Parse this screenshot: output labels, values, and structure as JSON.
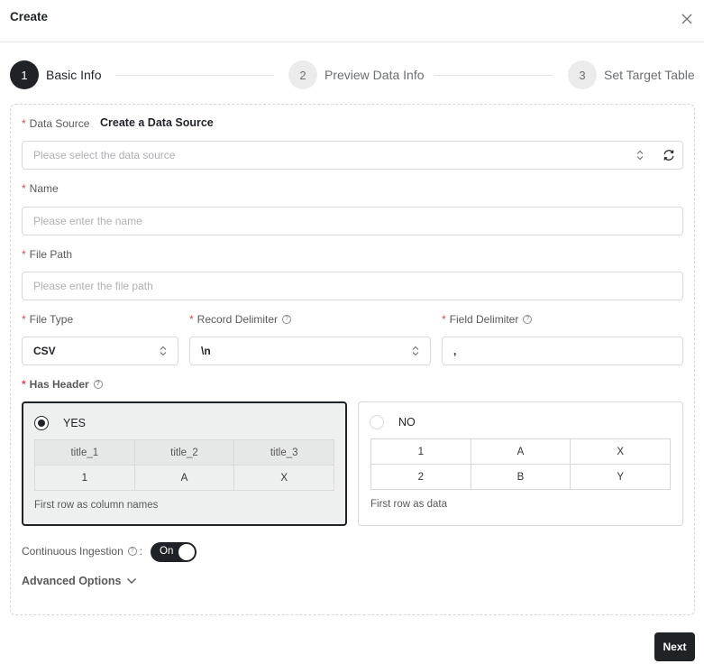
{
  "dialog": {
    "title": "Create"
  },
  "steps": [
    {
      "number": "1",
      "label": "Basic Info",
      "state": "active"
    },
    {
      "number": "2",
      "label": "Preview Data Info",
      "state": "inactive"
    },
    {
      "number": "3",
      "label": "Set Target Table",
      "state": "inactive"
    }
  ],
  "form": {
    "data_source": {
      "label": "Data Source",
      "create_link": "Create a Data Source",
      "placeholder": "Please select the data source"
    },
    "name": {
      "label": "Name",
      "placeholder": "Please enter the name"
    },
    "file_path": {
      "label": "File Path",
      "placeholder": "Please enter the file path"
    },
    "file_type": {
      "label": "File Type",
      "value": "CSV"
    },
    "record_delimiter": {
      "label": "Record Delimiter",
      "value": "\\n"
    },
    "field_delimiter": {
      "label": "Field Delimiter",
      "value": ","
    },
    "has_header": {
      "label": "Has Header",
      "yes": {
        "label": "YES",
        "selected": true,
        "header": [
          "title_1",
          "title_2",
          "title_3"
        ],
        "row": [
          "1",
          "A",
          "X"
        ],
        "note": "First row as column names"
      },
      "no": {
        "label": "NO",
        "selected": false,
        "rows": [
          [
            "1",
            "A",
            "X"
          ],
          [
            "2",
            "B",
            "Y"
          ]
        ],
        "note": "First row as data"
      }
    },
    "continuous_ingestion": {
      "label": "Continuous Ingestion",
      "colon": ":",
      "toggle_text": "On",
      "enabled": true
    },
    "advanced_options": {
      "label": "Advanced Options"
    }
  },
  "footer": {
    "next_label": "Next"
  },
  "icons": {
    "close": "close-icon",
    "caret": "up-down-caret-icon",
    "refresh": "refresh-icon",
    "help": "question-circle-icon",
    "chevron": "chevron-down-icon"
  },
  "colors": {
    "primary": "#1f2328",
    "required": "#e5484d",
    "border": "#d9d9d9"
  }
}
